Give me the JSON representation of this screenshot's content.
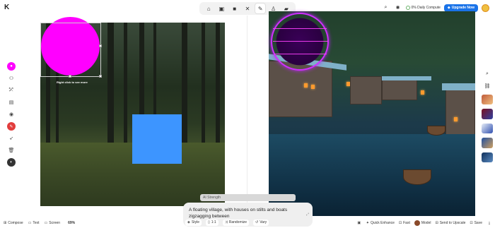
{
  "app": {
    "logo_glyph": "K"
  },
  "top_tools": [
    {
      "name": "home",
      "glyph": "⌂",
      "active": false
    },
    {
      "name": "image",
      "glyph": "▣",
      "active": false
    },
    {
      "name": "video",
      "glyph": "■",
      "active": false
    },
    {
      "name": "enhance",
      "glyph": "✕",
      "active": false
    },
    {
      "name": "brush",
      "glyph": "✎",
      "active": true
    },
    {
      "name": "train",
      "glyph": "♙",
      "active": false
    },
    {
      "name": "folder",
      "glyph": "▰",
      "active": false
    }
  ],
  "top_right": {
    "search_glyph": "⌕",
    "theme_glyph": "✺",
    "compute_label": "0% Daily Compute",
    "upgrade_label": "Upgrade Now",
    "upgrade_glyph": "◆"
  },
  "canvas": {
    "hint": "Right click to see more"
  },
  "strength_label": "AI Strength",
  "prompt": {
    "text": "A floating village, with houses on stilts and boats zigzagging between"
  },
  "prompt_actions": [
    {
      "name": "style",
      "glyph": "◈",
      "label": "Style"
    },
    {
      "name": "ratio",
      "glyph": "▯",
      "label": "1:1"
    },
    {
      "name": "randomize",
      "glyph": "⤨",
      "label": "Randomize"
    },
    {
      "name": "vary",
      "glyph": "↺",
      "label": "Vary"
    }
  ],
  "bottom_left": [
    {
      "name": "compose",
      "glyph": "⊞",
      "label": "Compose"
    },
    {
      "name": "text",
      "glyph": "▭",
      "label": "Text"
    },
    {
      "name": "screen",
      "glyph": "▭",
      "label": "Screen"
    }
  ],
  "zoom": "69%",
  "bottom_right": [
    {
      "name": "quick-enhance",
      "glyph": "✦",
      "label": "Quick Enhance"
    },
    {
      "name": "fast",
      "glyph": "⊡",
      "label": "Fast"
    },
    {
      "name": "model",
      "glyph": "",
      "label": "Model"
    },
    {
      "name": "send-to-upscale",
      "glyph": "⊟",
      "label": "Send to Upscale"
    },
    {
      "name": "save",
      "glyph": "⊡",
      "label": "Save"
    }
  ],
  "colors": {
    "accent": "#1a73e8",
    "magenta": "#ff00ff",
    "blue_shape": "#3d95ff"
  }
}
